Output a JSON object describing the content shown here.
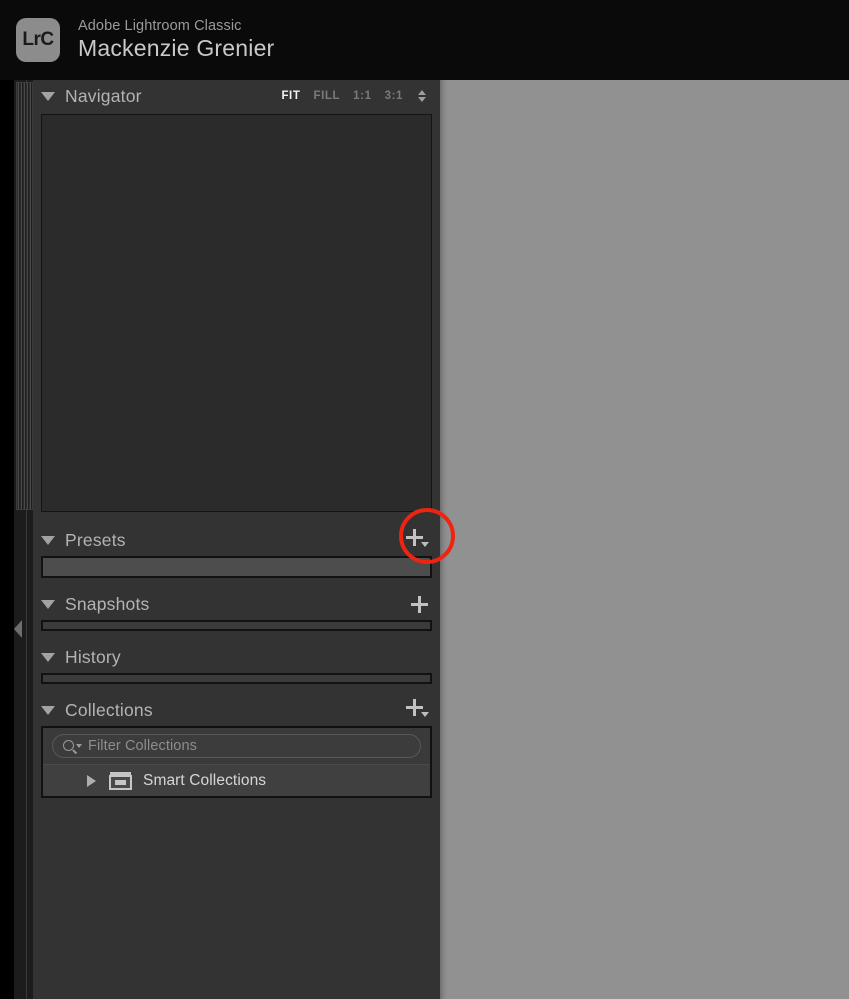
{
  "titlebar": {
    "logo_text": "LrC",
    "app_name": "Adobe Lightroom Classic",
    "document_name": "Mackenzie Grenier"
  },
  "left_panel": {
    "sections": [
      {
        "id": "navigator",
        "title": "Navigator",
        "expanded": true,
        "zoom_levels": [
          {
            "label": "FIT",
            "active": true
          },
          {
            "label": "FILL",
            "active": false
          },
          {
            "label": "1:1",
            "active": false
          },
          {
            "label": "3:1",
            "active": false
          }
        ]
      },
      {
        "id": "presets",
        "title": "Presets",
        "expanded": true,
        "add_label": "+",
        "highlighted": true
      },
      {
        "id": "snapshots",
        "title": "Snapshots",
        "expanded": true,
        "add_label": "+"
      },
      {
        "id": "history",
        "title": "History",
        "expanded": true
      },
      {
        "id": "collections",
        "title": "Collections",
        "expanded": true,
        "add_label": "+"
      }
    ],
    "collections": {
      "filter_placeholder": "Filter Collections",
      "filter_value": "",
      "rows": [
        {
          "label": "Smart Collections",
          "expanded": false
        }
      ]
    }
  },
  "annotation": {
    "target": "presets-add-button",
    "color": "#ee2411"
  },
  "colors": {
    "panel_background": "#333333",
    "canvas_background": "#919191",
    "titlebar_background": "#0a0a0a",
    "accent_red": "#ee2411"
  }
}
